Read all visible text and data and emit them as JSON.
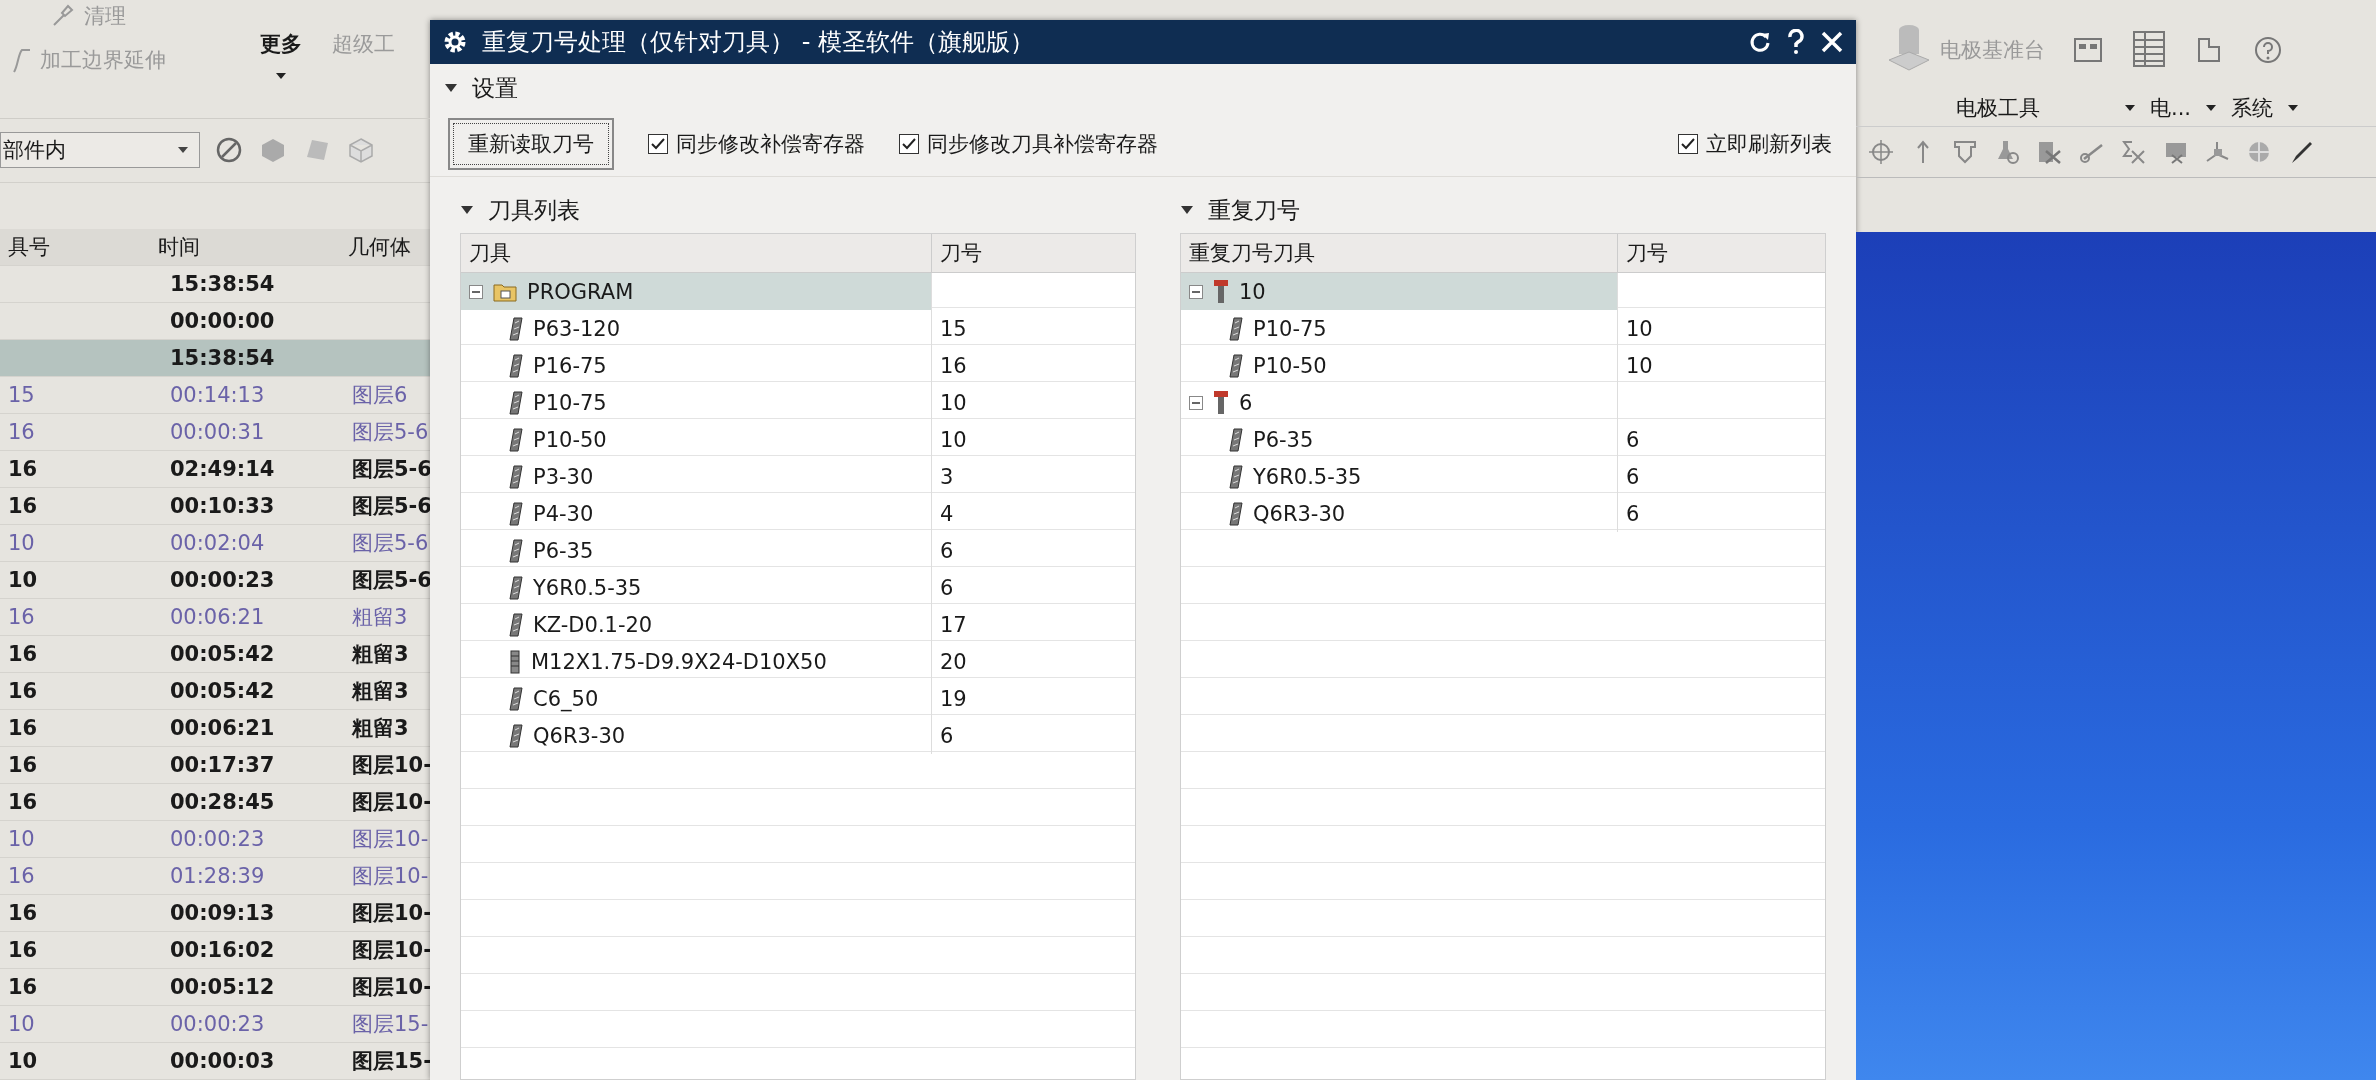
{
  "background_app": {
    "ribbon_left": {
      "items": [
        {
          "label": "清理"
        },
        {
          "label": "加工边界延伸"
        }
      ],
      "more": "更多",
      "disabled_tab": "超级工"
    },
    "filter_combo": {
      "value": "部件内"
    },
    "operations_table": {
      "columns": [
        "具号",
        "时间",
        "几何体"
      ],
      "rows": [
        {
          "time": "15:38:54",
          "dimmed": false,
          "selected": false
        },
        {
          "time": "00:00:00",
          "dimmed": false,
          "selected": false
        },
        {
          "time": "15:38:54",
          "dimmed": false,
          "selected": true
        },
        {
          "tool": "15",
          "time": "00:14:13",
          "geometry": "图层6",
          "dimmed": true,
          "selected": false
        },
        {
          "tool": "16",
          "time": "00:00:31",
          "geometry": "图层5-6",
          "dimmed": true,
          "selected": false
        },
        {
          "tool": "16",
          "time": "02:49:14",
          "geometry": "图层5-6",
          "dimmed": false,
          "selected": false
        },
        {
          "tool": "16",
          "time": "00:10:33",
          "geometry": "图层5-6",
          "dimmed": false,
          "selected": false
        },
        {
          "tool": "10",
          "time": "00:02:04",
          "geometry": "图层5-6",
          "dimmed": true,
          "selected": false
        },
        {
          "tool": "10",
          "time": "00:00:23",
          "geometry": "图层5-6",
          "dimmed": false,
          "selected": false
        },
        {
          "tool": "16",
          "time": "00:06:21",
          "geometry": "粗留3",
          "dimmed": true,
          "selected": false
        },
        {
          "tool": "16",
          "time": "00:05:42",
          "geometry": "粗留3",
          "dimmed": false,
          "selected": false
        },
        {
          "tool": "16",
          "time": "00:05:42",
          "geometry": "粗留3",
          "dimmed": false,
          "selected": false
        },
        {
          "tool": "16",
          "time": "00:06:21",
          "geometry": "粗留3",
          "dimmed": false,
          "selected": false
        },
        {
          "tool": "16",
          "time": "00:17:37",
          "geometry": "图层10-",
          "dimmed": false,
          "selected": false
        },
        {
          "tool": "16",
          "time": "00:28:45",
          "geometry": "图层10-",
          "dimmed": false,
          "selected": false
        },
        {
          "tool": "10",
          "time": "00:00:23",
          "geometry": "图层10-",
          "dimmed": true,
          "selected": false
        },
        {
          "tool": "16",
          "time": "01:28:39",
          "geometry": "图层10-",
          "dimmed": true,
          "selected": false
        },
        {
          "tool": "16",
          "time": "00:09:13",
          "geometry": "图层10-",
          "dimmed": false,
          "selected": false
        },
        {
          "tool": "16",
          "time": "00:16:02",
          "geometry": "图层10-",
          "dimmed": false,
          "selected": false
        },
        {
          "tool": "16",
          "time": "00:05:12",
          "geometry": "图层10-",
          "dimmed": false,
          "selected": false
        },
        {
          "tool": "10",
          "time": "00:00:23",
          "geometry": "图层15-",
          "dimmed": true,
          "selected": false
        },
        {
          "tool": "10",
          "time": "00:00:03",
          "geometry": "图层15-",
          "dimmed": false,
          "selected": false
        }
      ]
    },
    "ribbon_right": {
      "electrode_base": "电极基准台",
      "groups": [
        "电极工具",
        "电...",
        "系统"
      ]
    }
  },
  "dialog": {
    "title": "重复刀号处理（仅针对刀具） - 模圣软件（旗舰版）",
    "settings": {
      "title": "设置",
      "expanded": true,
      "reload_button": "重新读取刀号",
      "options": [
        {
          "label": "同步修改补偿寄存器",
          "checked": true
        },
        {
          "label": "同步修改刀具补偿寄存器",
          "checked": true
        },
        {
          "label": "立即刷新列表",
          "checked": true
        }
      ]
    },
    "tool_list": {
      "title": "刀具列表",
      "expanded": true,
      "columns": [
        "刀具",
        "刀号"
      ],
      "tree": [
        {
          "name": "PROGRAM",
          "kind": "folder",
          "expanded": true,
          "selected": true,
          "children": [
            {
              "name": "P63-120",
              "number": "15",
              "kind": "tool",
              "selected": false
            },
            {
              "name": "P16-75",
              "number": "16",
              "kind": "tool",
              "selected": false
            },
            {
              "name": "P10-75",
              "number": "10",
              "kind": "tool",
              "selected": false
            },
            {
              "name": "P10-50",
              "number": "10",
              "kind": "tool",
              "selected": false
            },
            {
              "name": "P3-30",
              "number": "3",
              "kind": "tool",
              "selected": false
            },
            {
              "name": "P4-30",
              "number": "4",
              "kind": "tool",
              "selected": false
            },
            {
              "name": "P6-35",
              "number": "6",
              "kind": "tool",
              "selected": false
            },
            {
              "name": "Y6R0.5-35",
              "number": "6",
              "kind": "tool",
              "selected": false
            },
            {
              "name": "KZ-D0.1-20",
              "number": "17",
              "kind": "tool",
              "selected": false
            },
            {
              "name": "M12X1.75-D9.9X24-D10X50",
              "number": "20",
              "kind": "tap",
              "selected": false
            },
            {
              "name": "C6_50",
              "number": "19",
              "kind": "tool",
              "selected": false
            },
            {
              "name": "Q6R3-30",
              "number": "6",
              "kind": "tool",
              "selected": false
            }
          ]
        }
      ]
    },
    "duplicates": {
      "title": "重复刀号",
      "expanded": true,
      "columns": [
        "重复刀号刀具",
        "刀号"
      ],
      "tree": [
        {
          "name": "10",
          "kind": "group",
          "expanded": true,
          "selected": true,
          "children": [
            {
              "name": "P10-75",
              "number": "10",
              "kind": "tool",
              "selected": false
            },
            {
              "name": "P10-50",
              "number": "10",
              "kind": "tool",
              "selected": false
            }
          ]
        },
        {
          "name": "6",
          "kind": "group",
          "expanded": true,
          "selected": false,
          "children": [
            {
              "name": "P6-35",
              "number": "6",
              "kind": "tool",
              "selected": false
            },
            {
              "name": "Y6R0.5-35",
              "number": "6",
              "kind": "tool",
              "selected": false
            },
            {
              "name": "Q6R3-30",
              "number": "6",
              "kind": "tool",
              "selected": false
            }
          ]
        }
      ]
    }
  }
}
